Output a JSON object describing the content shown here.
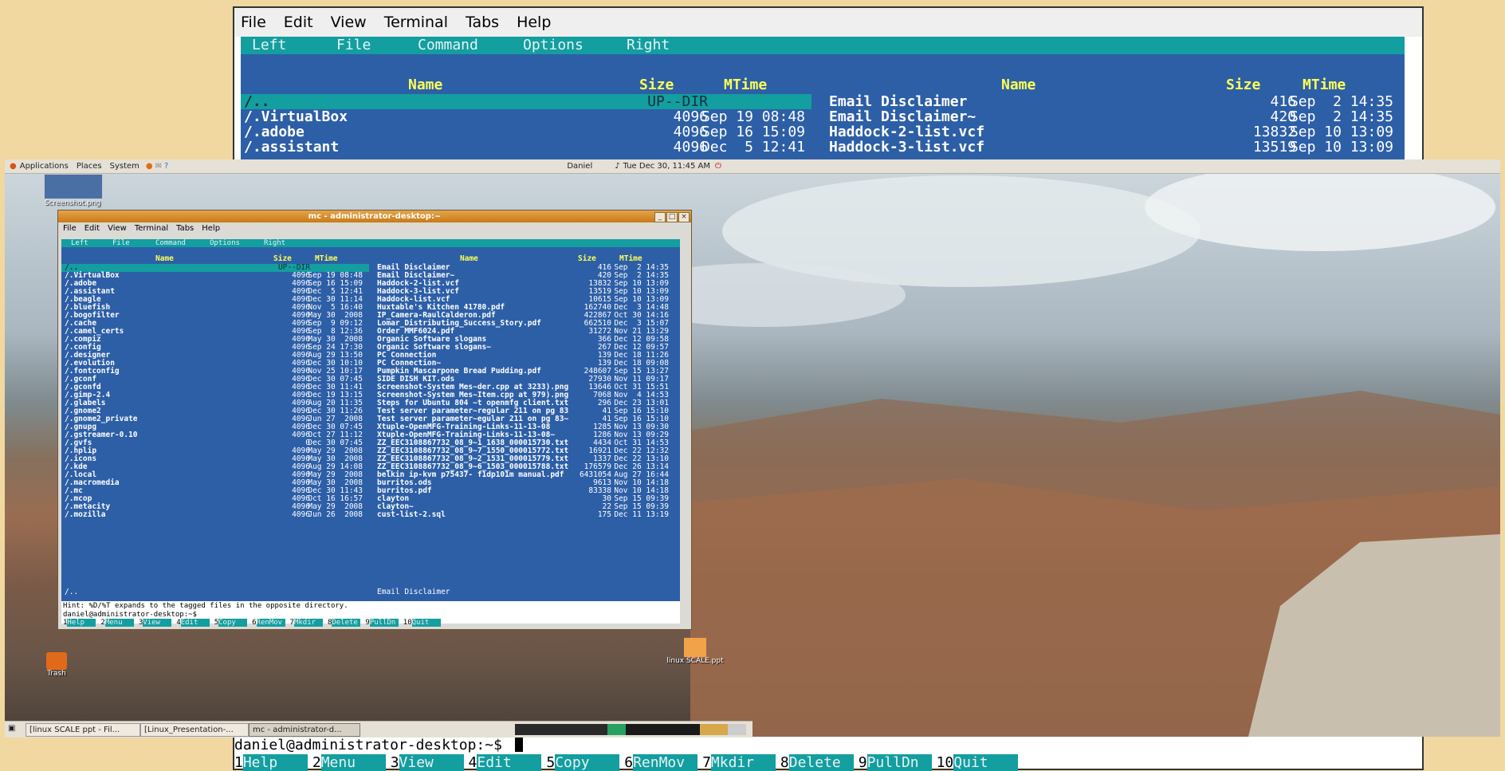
{
  "bg_terminal": {
    "menu": [
      "File",
      "Edit",
      "View",
      "Terminal",
      "Tabs",
      "Help"
    ],
    "mc_menu": [
      "Left",
      "File",
      "Command",
      "Options",
      "Right"
    ],
    "left_headers": [
      "Name",
      "Size",
      "MTime"
    ],
    "right_headers": [
      "Name",
      "Size",
      "MTime"
    ],
    "left_rows": [
      [
        "/..",
        "UP--DIR",
        ""
      ],
      [
        "/.VirtualBox",
        "4096",
        "Sep 19 08:48"
      ],
      [
        "/.adobe",
        "4096",
        "Sep 16 15:09"
      ],
      [
        "/.assistant",
        "4096",
        "Dec  5 12:41"
      ]
    ],
    "right_rows": [
      [
        "Email Disclaimer",
        "416",
        "Sep  2 14:35"
      ],
      [
        "Email Disclaimer~",
        "420",
        "Sep  2 14:35"
      ],
      [
        "Haddock-2-list.vcf",
        "13832",
        "Sep 10 13:09"
      ],
      [
        "Haddock-3-list.vcf",
        "13519",
        "Sep 10 13:09"
      ]
    ],
    "prompt": "daniel@administrator-desktop:~$",
    "fkeys": [
      [
        "1",
        "Help"
      ],
      [
        "2",
        "Menu"
      ],
      [
        "3",
        "View"
      ],
      [
        "4",
        "Edit"
      ],
      [
        "5",
        "Copy"
      ],
      [
        "6",
        "RenMov"
      ],
      [
        "7",
        "Mkdir"
      ],
      [
        "8",
        "Delete"
      ],
      [
        "9",
        "PullDn"
      ],
      [
        "10",
        "Quit"
      ]
    ]
  },
  "top_panel": {
    "menus": [
      "Applications",
      "Places",
      "System"
    ],
    "user": "Daniel",
    "clock": "Tue Dec 30, 11:45 AM"
  },
  "desktop_icons": [
    {
      "label": "Screenshot.png"
    },
    {
      "label": "Trash"
    },
    {
      "label": "linux SCALE.ppt"
    }
  ],
  "window": {
    "title": "mc - administrator-desktop:~",
    "menu": [
      "File",
      "Edit",
      "View",
      "Terminal",
      "Tabs",
      "Help"
    ],
    "mc_menu": [
      "Left",
      "File",
      "Command",
      "Options",
      "Right"
    ],
    "left_rows": [
      [
        "/..",
        "UP--DIR",
        ""
      ],
      [
        "/.VirtualBox",
        "4096",
        "Sep 19 08:48"
      ],
      [
        "/.adobe",
        "4096",
        "Sep 16 15:09"
      ],
      [
        "/.assistant",
        "4096",
        "Dec  5 12:41"
      ],
      [
        "/.beagle",
        "4096",
        "Dec 30 11:14"
      ],
      [
        "/.bluefish",
        "4096",
        "Nov  5 16:40"
      ],
      [
        "/.bogofilter",
        "4096",
        "May 30  2008"
      ],
      [
        "/.cache",
        "4096",
        "Sep  9 09:12"
      ],
      [
        "/.camel_certs",
        "4096",
        "Sep  8 12:36"
      ],
      [
        "/.compiz",
        "4096",
        "May 30  2008"
      ],
      [
        "/.config",
        "4096",
        "Sep 24 17:30"
      ],
      [
        "/.designer",
        "4096",
        "Aug 29 13:50"
      ],
      [
        "/.evolution",
        "4096",
        "Dec 30 10:10"
      ],
      [
        "/.fontconfig",
        "4096",
        "Nov 25 10:17"
      ],
      [
        "/.gconf",
        "4096",
        "Dec 30 07:45"
      ],
      [
        "/.gconfd",
        "4096",
        "Dec 30 11:41"
      ],
      [
        "/.gimp-2.4",
        "4096",
        "Dec 19 13:15"
      ],
      [
        "/.glabels",
        "4096",
        "Aug 20 11:35"
      ],
      [
        "/.gnome2",
        "4096",
        "Dec 30 11:26"
      ],
      [
        "/.gnome2_private",
        "4096",
        "Jun 27  2008"
      ],
      [
        "/.gnupg",
        "4096",
        "Dec 30 07:45"
      ],
      [
        "/.gstreamer-0.10",
        "4096",
        "Oct 27 11:12"
      ],
      [
        "/.gvfs",
        "0",
        "Dec 30 07:45"
      ],
      [
        "/.hplip",
        "4096",
        "May 29  2008"
      ],
      [
        "/.icons",
        "4096",
        "May 30  2008"
      ],
      [
        "/.kde",
        "4096",
        "Aug 29 14:08"
      ],
      [
        "/.local",
        "4096",
        "May 29  2008"
      ],
      [
        "/.macromedia",
        "4096",
        "May 30  2008"
      ],
      [
        "/.mc",
        "4096",
        "Dec 30 11:43"
      ],
      [
        "/.mcop",
        "4096",
        "Oct 16 16:57"
      ],
      [
        "/.metacity",
        "4096",
        "May 29  2008"
      ],
      [
        "/.mozilla",
        "4096",
        "Jun 26  2008"
      ]
    ],
    "right_rows": [
      [
        "Email Disclaimer",
        "416",
        "Sep  2 14:35"
      ],
      [
        "Email Disclaimer~",
        "420",
        "Sep  2 14:35"
      ],
      [
        "Haddock-2-list.vcf",
        "13832",
        "Sep 10 13:09"
      ],
      [
        "Haddock-3-list.vcf",
        "13519",
        "Sep 10 13:09"
      ],
      [
        "Haddock-list.vcf",
        "10615",
        "Sep 10 13:09"
      ],
      [
        "Huxtable's Kitchen 41780.pdf",
        "162740",
        "Dec  3 14:48"
      ],
      [
        "IP_Camera-RaulCalderon.pdf",
        "422867",
        "Oct 30 14:16"
      ],
      [
        "Lomar_Distributing_Success_Story.pdf",
        "662510",
        "Dec  3 15:07"
      ],
      [
        "Order MMF6024.pdf",
        "31272",
        "Nov 21 13:29"
      ],
      [
        "Organic Software slogans",
        "366",
        "Dec 12 09:58"
      ],
      [
        "Organic Software slogans~",
        "267",
        "Dec 12 09:57"
      ],
      [
        "PC Connection",
        "139",
        "Dec 18 11:26"
      ],
      [
        "PC Connection~",
        "139",
        "Dec 18 09:08"
      ],
      [
        "Pumpkin Mascarpone Bread Pudding.pdf",
        "248607",
        "Sep 15 13:27"
      ],
      [
        "SIDE DISH KIT.ods",
        "27930",
        "Nov 11 09:17"
      ],
      [
        "Screenshot-System Mes~der.cpp at 3233).png",
        "13646",
        "Oct 31 15:51"
      ],
      [
        "Screenshot-System Mes~Item.cpp at 979).png",
        "7068",
        "Nov  4 14:53"
      ],
      [
        "Steps for Ubuntu 804 ~t openmfg client.txt",
        "296",
        "Dec 23 13:01"
      ],
      [
        "Test server parameter~regular 211 on pg 83",
        "41",
        "Sep 16 15:10"
      ],
      [
        "Test server parameter~egular 211 on pg 83~",
        "41",
        "Sep 16 15:10"
      ],
      [
        "Xtuple-OpenMFG-Training-Links-11-13-08",
        "1285",
        "Nov 13 09:30"
      ],
      [
        "Xtuple-OpenMFG-Training-Links-11-13-08~",
        "1286",
        "Nov 13 09:29"
      ],
      [
        "ZZ_EEC3108867732_08_9~1_1638_000015730.txt",
        "4434",
        "Oct 31 14:53"
      ],
      [
        "ZZ_EEC3108867732_08_9~7_1550_000015772.txt",
        "16921",
        "Dec 22 12:32"
      ],
      [
        "ZZ_EEC3108867732_08_9~2_1531_000015779.txt",
        "1337",
        "Dec 22 13:10"
      ],
      [
        "ZZ_EEC3108867732_08_9~6_1503_000015788.txt",
        "176579",
        "Dec 26 13:14"
      ],
      [
        "belkin ip-kvm p75437- f1dp101m manual.pdf",
        "6431054",
        "Aug 27 16:44"
      ],
      [
        "burritos.ods",
        "9613",
        "Nov 10 14:18"
      ],
      [
        "burritos.pdf",
        "83338",
        "Nov 10 14:18"
      ],
      [
        "clayton",
        "30",
        "Sep 15 09:39"
      ],
      [
        "clayton~",
        "22",
        "Sep 15 09:39"
      ],
      [
        "cust-list-2.sql",
        "175",
        "Dec 11 13:19"
      ]
    ],
    "left_footer": "/..",
    "right_footer": "Email Disclaimer",
    "hint": "Hint: %D/%T expands to the tagged files in the opposite directory.",
    "prompt": "daniel@administrator-desktop:~$"
  },
  "taskbar": {
    "items": [
      "[linux SCALE ppt - Fil...",
      "[Linux_Presentation-...",
      "mc - administrator-d..."
    ]
  },
  "colors": {
    "mc_teal": "#139ea0",
    "mc_blue": "#2d5fa7",
    "mc_header": "#ffff55",
    "title_orange": "#d98a24"
  }
}
